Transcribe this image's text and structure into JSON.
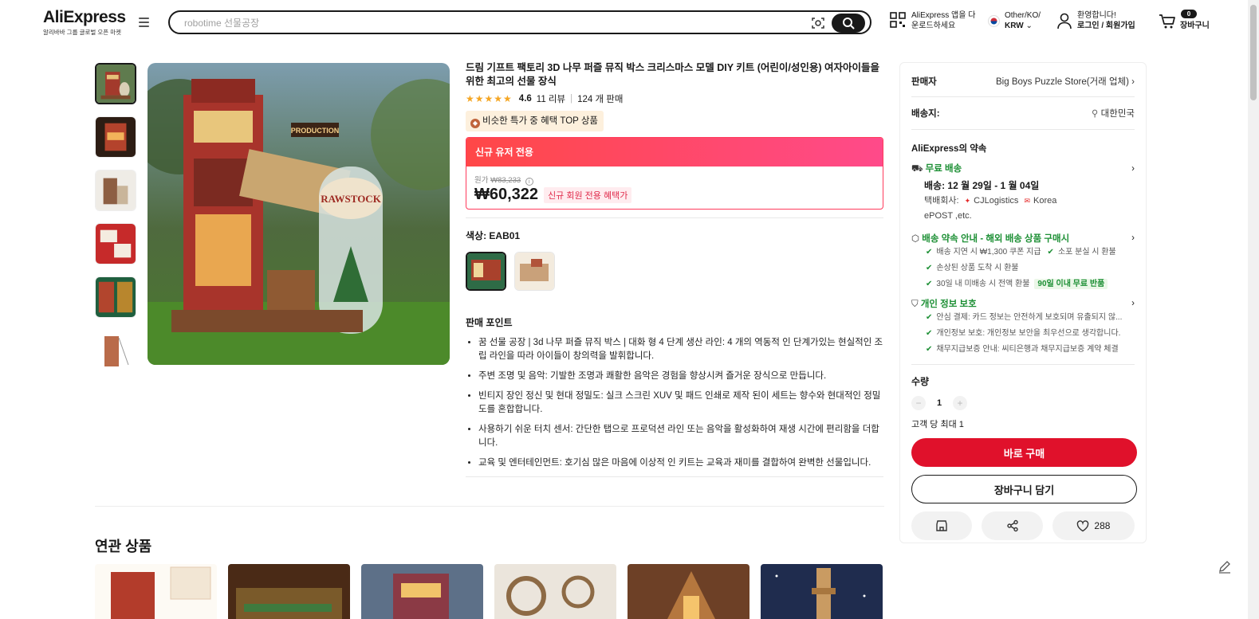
{
  "header": {
    "brand": "AliExpress",
    "tagline": "알리바바 그룹 글로벌 오픈 마켓",
    "search_placeholder": "robotime 선물공장",
    "app_line1": "AliExpress 앱을 다",
    "app_line2": "운로드하세요",
    "region_line1": "Other/KO/",
    "region_line2": "KRW",
    "account_line1": "환영합니다!",
    "account_line2": "로그인 / 회원가입",
    "cart_count": "0",
    "cart_label": "장바구니"
  },
  "product": {
    "title": "드림 기프트 팩토리 3D 나무 퍼즐 뮤직 박스 크리스마스 모델 DIY 키트 (어린이/성인용) 여자아이들을 위한 최고의 선물 장식",
    "rating_stars": "★★★★★",
    "rating_value": 4.6,
    "rating": "4.6",
    "reviews": "11 리뷰",
    "sold": "124 개 판매",
    "top_badge": "비슷한 특가 중 혜택 TOP 상품",
    "deal_header": "신규 유저 전용",
    "orig_label": "원가",
    "orig_price": "₩83,233",
    "price": "₩60,322",
    "price_tag": "신규 회원 전용 혜택가",
    "color_label": "색상: EAB01",
    "selling_points_title": "판매 포인트",
    "selling_points": [
      "꿈 선물 공장 | 3d 나무 퍼즐 뮤직 박스 | 대화 형 4 단계 생산 라인: 4 개의 역동적 인 단계가있는 현실적인 조립 라인을 따라 아이들이 창의력을 발휘합니다.",
      "주변 조명 및 음악: 기발한 조명과 쾌활한 음악은 경험을 향상시켜 즐거운 장식으로 만듭니다.",
      "빈티지 장인 정신 및 현대 정밀도: 실크 스크린 XUV 및 패드 인쇄로 제작 된이 세트는 향수와 현대적인 정밀도를 혼합합니다.",
      "사용하기 쉬운 터치 센서: 간단한 탭으로 프로덕션 라인 또는 음악을 활성화하여 재생 시간에 편리함을 더합니다.",
      "교육 및 엔터테인먼트: 호기심 많은 마음에 이상적 인 키트는 교육과 재미를 결합하여 완벽한 선물입니다."
    ]
  },
  "panel": {
    "seller_key": "판매자",
    "seller_name": "Big Boys Puzzle Store(거래 업체)",
    "ship_key": "배송지:",
    "ship_to": "대한민국",
    "promise_title": "AliExpress의 약속",
    "free_ship": "무료 배송",
    "delivery": "배송: 12 월 29일 - 1 월 04일",
    "carrier_label": "택배회사:",
    "carrier1": "CJLogistics",
    "carrier2": "Korea",
    "carrier3": "ePOST ,etc.",
    "ship_promise": "배송 약속 안내 - 해외 배송 상품 구매시",
    "sp1": "배송 지연 시 ₩1,300 쿠폰 지급",
    "sp2": "소포 분실 시 환불",
    "sp3": "손상된 상품 도착 시 환불",
    "sp4": "30일 내 미배송 시 전액 환불",
    "sp4_chip": "90일 이내 무료 반품",
    "privacy": "개인 정보 보호",
    "pv1": "안심 결제: 카드 정보는 안전하게 보호되며 유출되지 않...",
    "pv2": "개인정보 보호: 개인정보 보안을 최우선으로 생각합니다.",
    "pv3": "채무지급보증 안내: 씨티은행과 채무지급보증 계약 체결",
    "qty_label": "수량",
    "qty_minus": "−",
    "qty_value": "1",
    "qty_plus": "+",
    "qty_limit": "고객 당 최대 1",
    "buy_now": "바로 구매",
    "add_cart": "장바구니 담기",
    "wish_count": "288"
  },
  "related": {
    "title": "연관 상품"
  },
  "colors": {
    "brand_red": "#e0112b",
    "deal_gradient_start": "#ff4747",
    "deal_gradient_end": "#ff4a8a",
    "promise_green": "#1c8f34"
  }
}
